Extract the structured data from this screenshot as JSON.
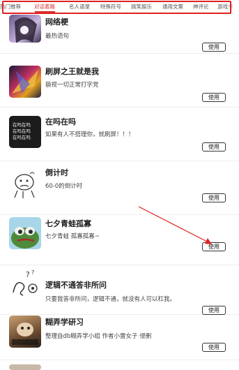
{
  "tabs": [
    {
      "label": "热门推荐",
      "active": false
    },
    {
      "label": "对话套路",
      "active": true
    },
    {
      "label": "名人语录",
      "active": false
    },
    {
      "label": "特殊符号",
      "active": false
    },
    {
      "label": "搞笑娱乐",
      "active": false
    },
    {
      "label": "通用文案",
      "active": false
    },
    {
      "label": "神评论",
      "active": false
    },
    {
      "label": "游戏卡",
      "active": false
    }
  ],
  "items": [
    {
      "title": "网络梗",
      "desc": "最热语句",
      "button": "使用",
      "icon": "anime-girl-thumbnail"
    },
    {
      "title": "刷屏之王就是我",
      "desc": "藐视一切正常打字党",
      "button": "使用",
      "icon": "game-hero-thumbnail"
    },
    {
      "title": "在吗在吗",
      "desc": "如果有人不搭理你，就刷屏！！！",
      "button": "使用",
      "icon": "text-card-thumbnail",
      "thumb_lines": [
        "在吗在吗",
        "在吗在吗",
        "在吗在吗"
      ]
    },
    {
      "title": "倒计时",
      "desc": "60-0的倒计时",
      "button": "使用",
      "icon": "sketch-face-thumbnail"
    },
    {
      "title": "七夕青蛙孤寡",
      "desc": "七夕青蛙 孤寡孤寡~",
      "button": "使用",
      "icon": "pepe-frog-thumbnail"
    },
    {
      "title": "逻辑不通答非所问",
      "desc": "只要我答非所问，逻辑不通，就没有人可以杠我。",
      "button": "使用",
      "icon": "question-figure-thumbnail"
    },
    {
      "title": "糊弄学研习",
      "desc": "整理自db糊弄学小组 作者小雷女子 侵删",
      "button": "使用",
      "icon": "cat-meme-thumbnail"
    },
    {
      "title": "",
      "desc": "",
      "button": "",
      "icon": "partial-thumbnail"
    }
  ],
  "colors": {
    "accent": "#d83030",
    "annotation": "#e02020"
  }
}
